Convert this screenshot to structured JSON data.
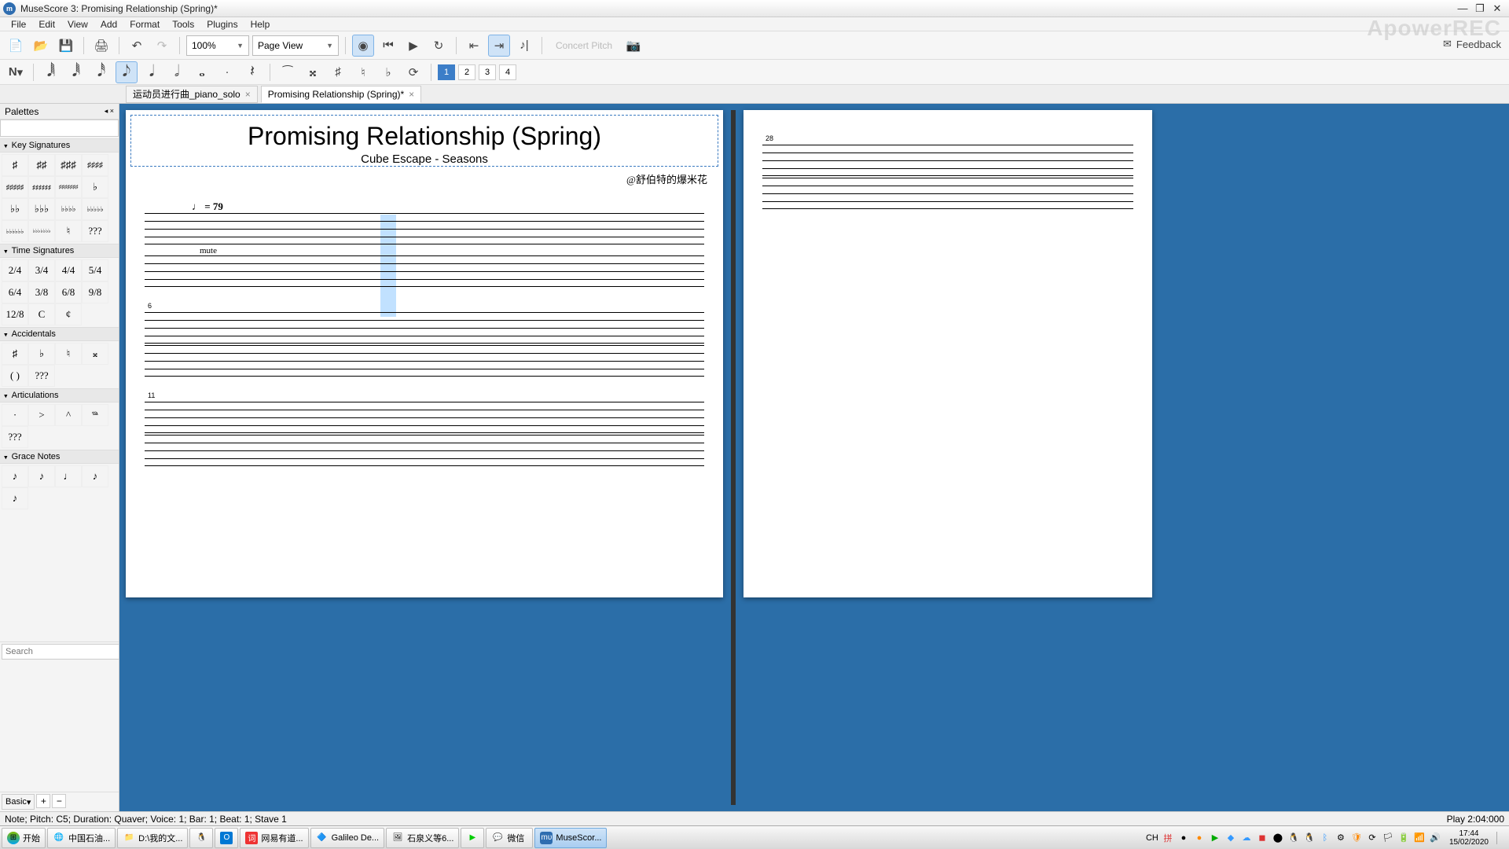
{
  "title": "MuseScore 3: Promising Relationship (Spring)*",
  "watermark": "ApowerREC",
  "menu": [
    "File",
    "Edit",
    "View",
    "Add",
    "Format",
    "Tools",
    "Plugins",
    "Help"
  ],
  "toolbar1": {
    "zoom": "100%",
    "view": "Page View",
    "concert_pitch": "Concert Pitch",
    "feedback": "Feedback"
  },
  "voices": [
    "1",
    "2",
    "3",
    "4"
  ],
  "tabs": [
    {
      "label": "运动员进行曲_piano_solo",
      "active": false
    },
    {
      "label": "Promising Relationship (Spring)*",
      "active": true
    }
  ],
  "palette": {
    "title": "Palettes",
    "sections": [
      "Key Signatures",
      "Time Signatures",
      "Accidentals",
      "Articulations",
      "Grace Notes"
    ],
    "keysigs": [
      "♯",
      "♯♯",
      "♯♯♯",
      "♯♯♯♯",
      "5♯",
      "6♯",
      "7♯",
      "♭",
      "♭♭",
      "♭♭♭",
      "♭♭♭♭",
      "5♭",
      "6♭",
      "7♭",
      "♮",
      "???"
    ],
    "timesigs": [
      "2/4",
      "3/4",
      "4/4",
      "5/4",
      "6/4",
      "3/8",
      "6/8",
      "9/8",
      "12/8",
      "C",
      "¢"
    ],
    "accidentals": [
      "♯",
      "♭",
      "♮",
      "𝄪",
      "( )",
      "???"
    ],
    "articulations": [
      "·",
      ">",
      "^",
      "𝆮",
      "???"
    ],
    "gracenotes": [
      "♪",
      "♪",
      "♩",
      "♪",
      "♪"
    ],
    "search_ph": "Search",
    "basic": "Basic"
  },
  "score": {
    "title": "Promising Relationship (Spring)",
    "subtitle": "Cube Escape - Seasons",
    "composer": "@舒伯特的爆米花",
    "tempo": "♩ = 79",
    "mute": "mute",
    "sys2": "6",
    "sys3": "11",
    "page2sys": "28"
  },
  "status": {
    "left": "Note; Pitch: C5; Duration: Quaver; Voice: 1;  Bar: 1; Beat: 1; Stave 1",
    "right": "Play  2:04:000"
  },
  "taskbar": {
    "start": "开始",
    "items": [
      {
        "ico": "🌐",
        "label": "中国石油..."
      },
      {
        "ico": "📁",
        "label": "D:\\我的文..."
      },
      {
        "ico": "🐧",
        "label": ""
      },
      {
        "ico": "📧",
        "label": ""
      },
      {
        "ico": "词",
        "label": "网易有道..."
      },
      {
        "ico": "🔷",
        "label": "Galileo De..."
      },
      {
        "ico": "🖼",
        "label": "石泉义等6..."
      },
      {
        "ico": "▶",
        "label": ""
      },
      {
        "ico": "💬",
        "label": "微信"
      },
      {
        "ico": "mu",
        "label": "MuseScor...",
        "active": true
      }
    ],
    "lang": "CH",
    "clock_time": "17:44",
    "clock_date": "15/02/2020"
  }
}
